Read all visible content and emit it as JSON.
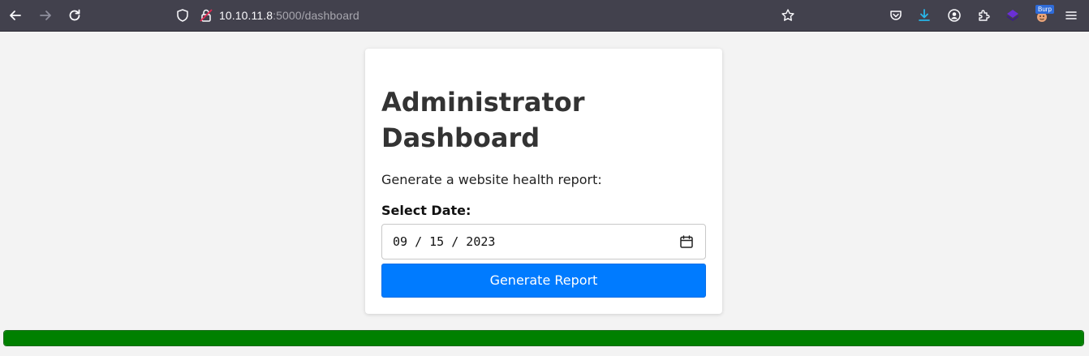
{
  "browser": {
    "url_host": "10.10.11.8",
    "url_rest": ":5000/dashboard",
    "burp_badge": "Burp"
  },
  "card": {
    "title": "Administrator Dashboard",
    "description": "Generate a website health report:",
    "date_label": "Select Date:",
    "date_value": "09 / 15 / 2023",
    "button_label": "Generate Report"
  },
  "progress": {
    "percent": 100,
    "color": "#008000"
  },
  "colors": {
    "accent": "#007bff",
    "toolbar": "#42414d",
    "page_bg": "#f3f3f3"
  }
}
